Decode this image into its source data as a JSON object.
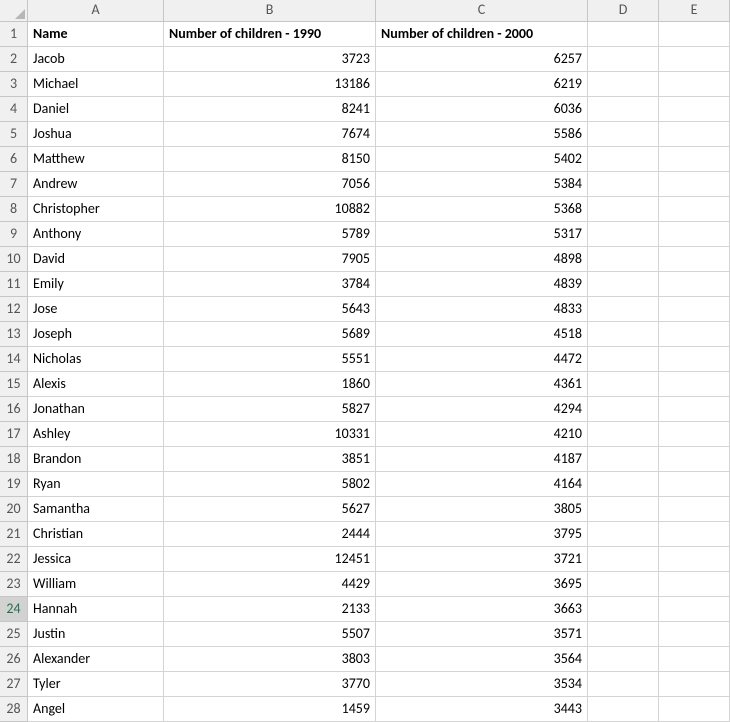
{
  "columns": [
    "A",
    "B",
    "C",
    "D",
    "E"
  ],
  "selectedRow": 24,
  "headerRow": {
    "A": "Name",
    "B": "Number of children - 1990",
    "C": "Number of children - 2000"
  },
  "rows": [
    {
      "name": "Jacob",
      "v1990": 3723,
      "v2000": 6257
    },
    {
      "name": "Michael",
      "v1990": 13186,
      "v2000": 6219
    },
    {
      "name": "Daniel",
      "v1990": 8241,
      "v2000": 6036
    },
    {
      "name": "Joshua",
      "v1990": 7674,
      "v2000": 5586
    },
    {
      "name": "Matthew",
      "v1990": 8150,
      "v2000": 5402
    },
    {
      "name": "Andrew",
      "v1990": 7056,
      "v2000": 5384
    },
    {
      "name": "Christopher",
      "v1990": 10882,
      "v2000": 5368
    },
    {
      "name": "Anthony",
      "v1990": 5789,
      "v2000": 5317
    },
    {
      "name": "David",
      "v1990": 7905,
      "v2000": 4898
    },
    {
      "name": "Emily",
      "v1990": 3784,
      "v2000": 4839
    },
    {
      "name": "Jose",
      "v1990": 5643,
      "v2000": 4833
    },
    {
      "name": "Joseph",
      "v1990": 5689,
      "v2000": 4518
    },
    {
      "name": "Nicholas",
      "v1990": 5551,
      "v2000": 4472
    },
    {
      "name": "Alexis",
      "v1990": 1860,
      "v2000": 4361
    },
    {
      "name": "Jonathan",
      "v1990": 5827,
      "v2000": 4294
    },
    {
      "name": "Ashley",
      "v1990": 10331,
      "v2000": 4210
    },
    {
      "name": "Brandon",
      "v1990": 3851,
      "v2000": 4187
    },
    {
      "name": "Ryan",
      "v1990": 5802,
      "v2000": 4164
    },
    {
      "name": "Samantha",
      "v1990": 5627,
      "v2000": 3805
    },
    {
      "name": "Christian",
      "v1990": 2444,
      "v2000": 3795
    },
    {
      "name": "Jessica",
      "v1990": 12451,
      "v2000": 3721
    },
    {
      "name": "William",
      "v1990": 4429,
      "v2000": 3695
    },
    {
      "name": "Hannah",
      "v1990": 2133,
      "v2000": 3663
    },
    {
      "name": "Justin",
      "v1990": 5507,
      "v2000": 3571
    },
    {
      "name": "Alexander",
      "v1990": 3803,
      "v2000": 3564
    },
    {
      "name": "Tyler",
      "v1990": 3770,
      "v2000": 3534
    },
    {
      "name": "Angel",
      "v1990": 1459,
      "v2000": 3443
    }
  ]
}
